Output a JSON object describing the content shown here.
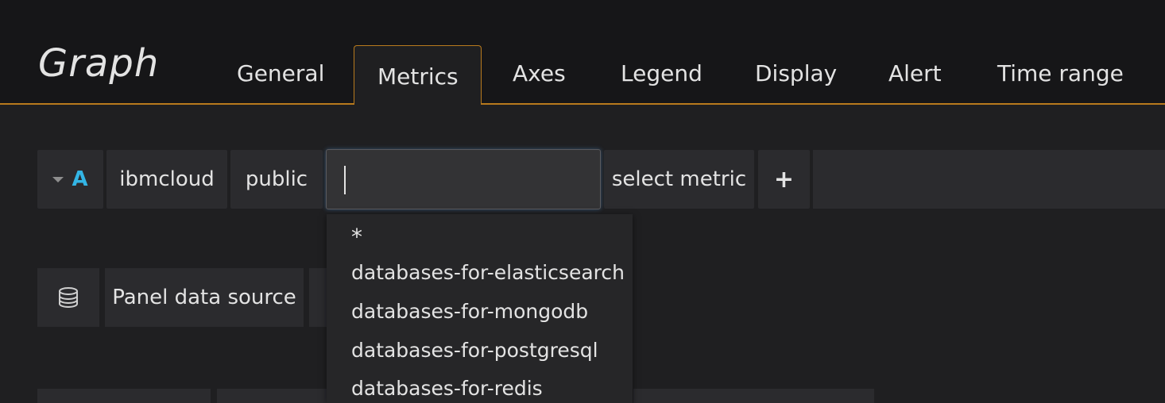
{
  "panel": {
    "title": "Graph"
  },
  "tabs": [
    {
      "label": "General"
    },
    {
      "label": "Metrics",
      "active": true
    },
    {
      "label": "Axes"
    },
    {
      "label": "Legend"
    },
    {
      "label": "Display"
    },
    {
      "label": "Alert"
    },
    {
      "label": "Time range"
    }
  ],
  "query": {
    "ref_id": "A",
    "namespace": "ibmcloud",
    "scope": "public",
    "input_value": "",
    "metric_label": "select metric",
    "add_label": "+"
  },
  "dropdown": {
    "items": [
      "*",
      "databases-for-elasticsearch",
      "databases-for-mongodb",
      "databases-for-postgresql",
      "databases-for-redis"
    ]
  },
  "datasource": {
    "icon": "database-icon",
    "label": "Panel data source"
  },
  "colors": {
    "accent": "#b87a1d",
    "ref_id": "#33b5e5",
    "background": "#1f1f21",
    "header_bg": "#161618"
  }
}
